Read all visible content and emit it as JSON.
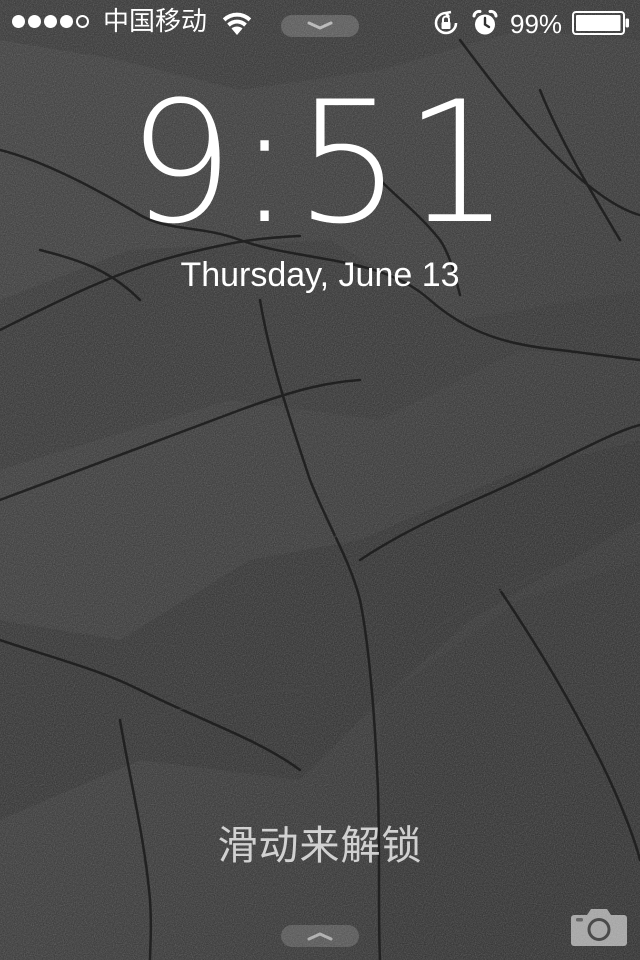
{
  "status_bar": {
    "signal_dots_filled": 4,
    "signal_dots_total": 5,
    "carrier": "中国移动",
    "battery_percent": "99%",
    "battery_level": 0.99,
    "icons": [
      "wifi-icon",
      "rotation-lock-icon",
      "alarm-icon",
      "battery-icon"
    ]
  },
  "lock_screen": {
    "time": "9:51",
    "date": "Thursday, June 13",
    "unlock_hint": "滑动来解锁",
    "camera_icon": "camera-icon"
  },
  "colors": {
    "text": "#ffffff",
    "wallpaper_base": "#2f2f2f"
  }
}
